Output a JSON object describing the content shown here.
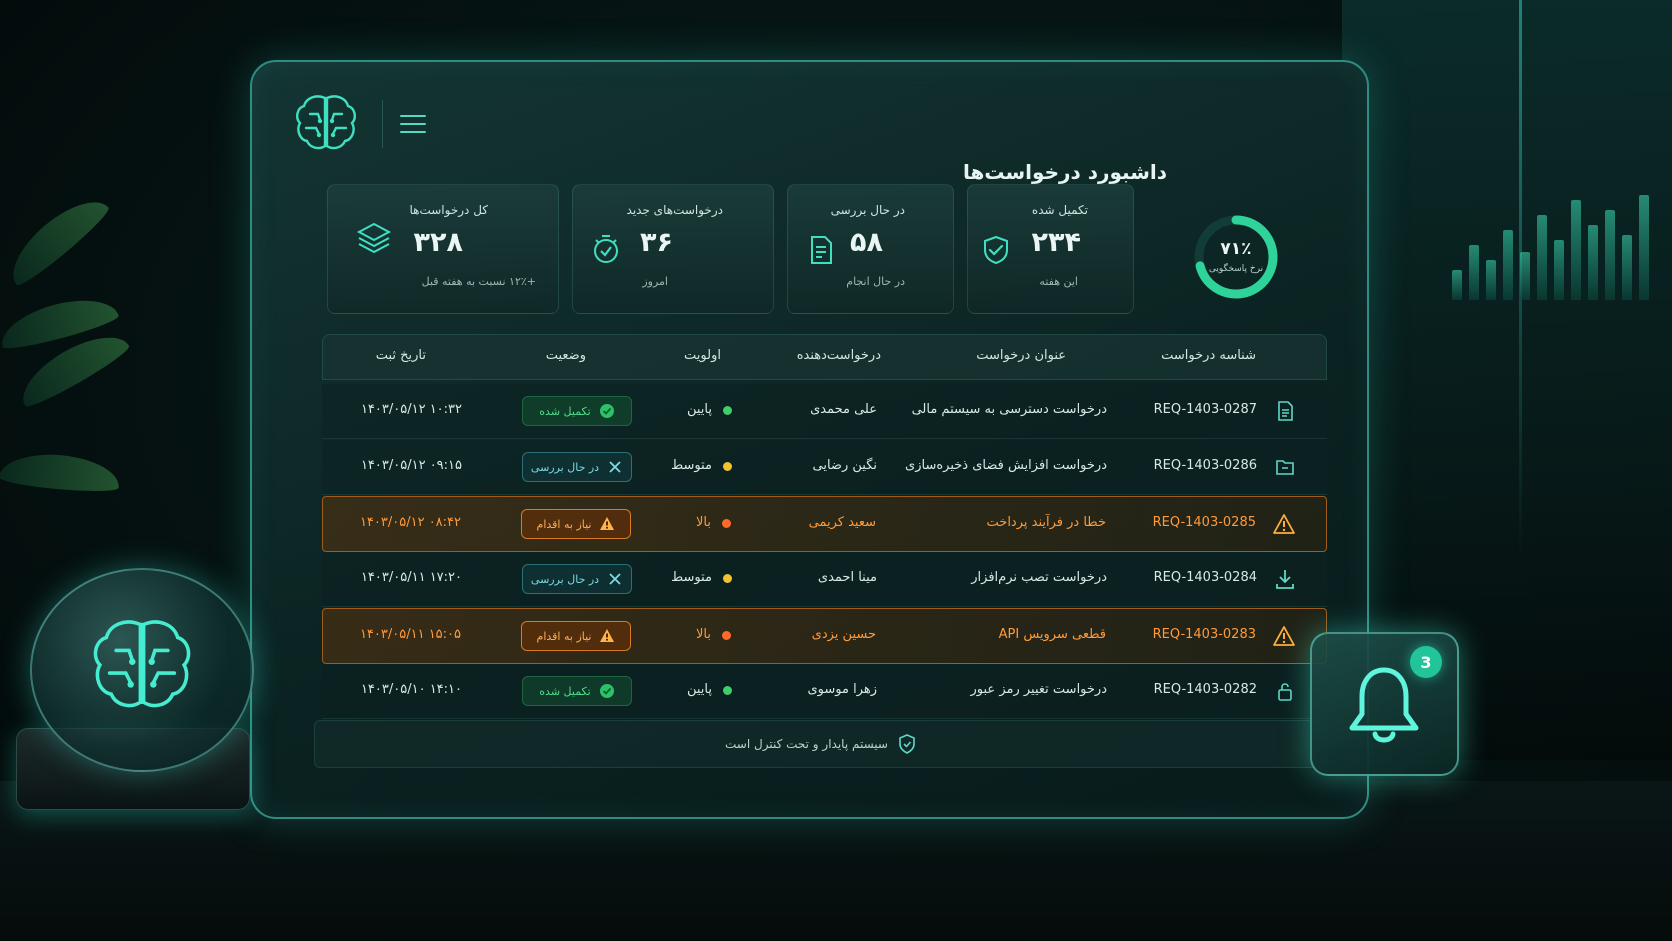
{
  "dashboard_title": "داشبورد درخواست‌ها",
  "stats": [
    {
      "label": "کل درخواست‌ها",
      "value": "۳۲۸",
      "sub": "+۱۲٪ نسبت به هفته قبل",
      "icon": "layers-icon"
    },
    {
      "label": "درخواست‌های جدید",
      "value": "۳۶",
      "sub": "امروز",
      "icon": "timer-check-icon"
    },
    {
      "label": "در حال بررسی",
      "value": "۵۸",
      "sub": "در حال انجام",
      "icon": "document-review-icon"
    },
    {
      "label": "تکمیل شده",
      "value": "۲۳۴",
      "sub": "این هفته",
      "icon": "shield-check-icon"
    }
  ],
  "response_rate": {
    "value": "۷۱٪",
    "label": "نرخ پاسخگویی",
    "fraction": 0.71
  },
  "table": {
    "columns": [
      "شناسه درخواست",
      "عنوان درخواست",
      "درخواست‌دهنده",
      "اولویت",
      "وضعیت",
      "تاریخ ثبت"
    ],
    "rows": [
      {
        "id": "REQ-1403-0287",
        "title": "درخواست دسترسی به سیستم مالی",
        "requester": "علی محمدی",
        "priority": "پایین",
        "priority_color": "#3ecf6a",
        "status": "تکمیل شده",
        "status_type": "done",
        "date": "۱۴۰۳/۰۵/۱۲  ۱۰:۳۲",
        "icon": "document-icon",
        "alert": false
      },
      {
        "id": "REQ-1403-0286",
        "title": "درخواست افزایش فضای ذخیره‌سازی",
        "requester": "نگین رضایی",
        "priority": "متوسط",
        "priority_color": "#f0c430",
        "status": "در حال بررسی",
        "status_type": "review",
        "date": "۱۴۰۳/۰۵/۱۲  ۰۹:۱۵",
        "icon": "folder-icon",
        "alert": false
      },
      {
        "id": "REQ-1403-0285",
        "title": "خطا در فرآیند پرداخت",
        "requester": "سعید کریمی",
        "priority": "بالا",
        "priority_color": "#ff6a2a",
        "status": "نیاز به اقدام",
        "status_type": "action",
        "date": "۱۴۰۳/۰۵/۱۲  ۰۸:۴۲",
        "icon": "warning-icon",
        "alert": true
      },
      {
        "id": "REQ-1403-0284",
        "title": "درخواست تصب نرم‌افزار",
        "requester": "مینا احمدی",
        "priority": "متوسط",
        "priority_color": "#f0c430",
        "status": "در حال بررسی",
        "status_type": "review",
        "date": "۱۴۰۳/۰۵/۱۱  ۱۷:۲۰",
        "icon": "download-icon",
        "alert": false
      },
      {
        "id": "REQ-1403-0283",
        "title": "قطعی سرویس API",
        "requester": "حسین یزدی",
        "priority": "بالا",
        "priority_color": "#ff6a2a",
        "status": "نیاز به اقدام",
        "status_type": "action",
        "date": "۱۴۰۳/۰۵/۱۱  ۱۵:۰۵",
        "icon": "warning-icon",
        "alert": true
      },
      {
        "id": "REQ-1403-0282",
        "title": "درخواست تغییر رمز عبور",
        "requester": "زهرا موسوی",
        "priority": "پایین",
        "priority_color": "#3ecf6a",
        "status": "تکمیل شده",
        "status_type": "done",
        "date": "۱۴۰۳/۰۵/۱۰  ۱۴:۱۰",
        "icon": "lock-icon",
        "alert": false
      }
    ]
  },
  "footer_text": "سیستم پایدار و تحت کنترل است",
  "notifications": {
    "count": "3"
  },
  "colors": {
    "accent": "#3fe0c0",
    "alert": "#ff9a3a",
    "done": "#4fdb8a"
  }
}
